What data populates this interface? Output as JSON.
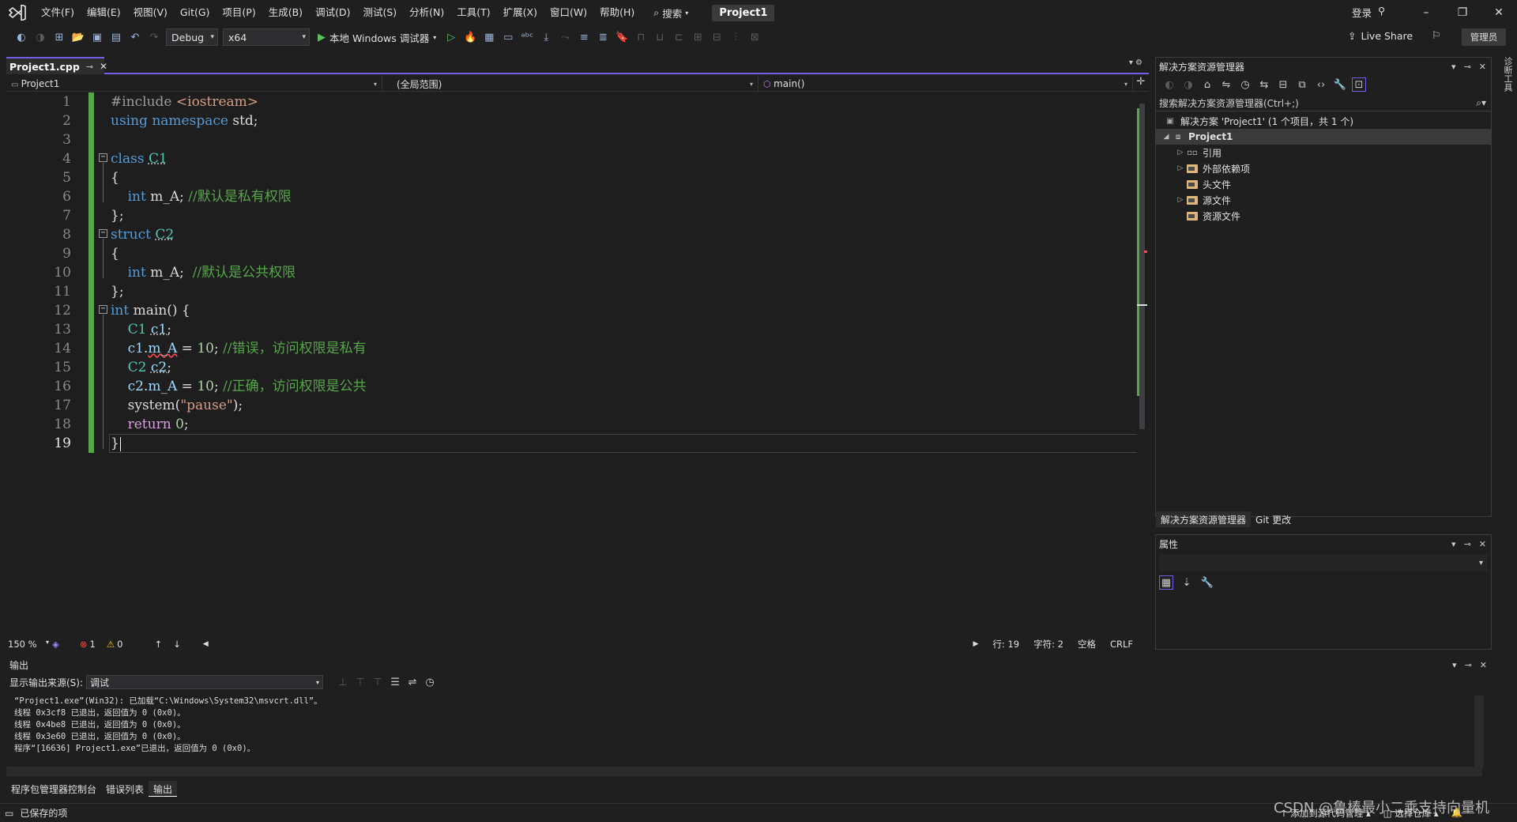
{
  "menubar": {
    "items": [
      "文件(F)",
      "编辑(E)",
      "视图(V)",
      "Git(G)",
      "项目(P)",
      "生成(B)",
      "调试(D)",
      "测试(S)",
      "分析(N)",
      "工具(T)",
      "扩展(X)",
      "窗口(W)",
      "帮助(H)"
    ],
    "search_label": "搜索",
    "project_title": "Project1",
    "login": "登录",
    "icons": {
      "logo": "visual-studio-logo",
      "search": "search-icon"
    }
  },
  "toolbar": {
    "config": "Debug",
    "platform": "x64",
    "run_label": "本地 Windows 调试器",
    "liveshare": "Live Share",
    "admin": "管理员"
  },
  "editor": {
    "tab_label": "Project1.cpp",
    "nav": {
      "project": "Project1",
      "scope": "(全局范围)",
      "member": "main()"
    },
    "line_numbers": [
      "1",
      "2",
      "3",
      "4",
      "5",
      "6",
      "7",
      "8",
      "9",
      "10",
      "11",
      "12",
      "13",
      "14",
      "15",
      "16",
      "17",
      "18",
      "19"
    ],
    "current_line": 19
  },
  "editor_status": {
    "zoom": "150 %",
    "errors": "1",
    "warnings": "0",
    "row": "行: 19",
    "col": "字符: 2",
    "whitespace": "空格",
    "eol": "CRLF"
  },
  "solution_explorer": {
    "title": "解决方案资源管理器",
    "search_placeholder": "搜索解决方案资源管理器(Ctrl+;)",
    "solution_line": "解决方案 'Project1' (1 个项目，共 1 个)",
    "project": "Project1",
    "nodes": [
      "引用",
      "外部依赖项",
      "头文件",
      "源文件",
      "资源文件"
    ],
    "tabs": [
      "解决方案资源管理器",
      "Git 更改"
    ]
  },
  "properties": {
    "title": "属性"
  },
  "output": {
    "title": "输出",
    "source_label": "显示输出来源(S):",
    "source_value": "调试",
    "lines": [
      "“Project1.exe”(Win32): 已加载“C:\\Windows\\System32\\msvcrt.dll”。",
      "线程 0x3cf8 已退出，返回值为 0 (0x0)。",
      "线程 0x4be8 已退出，返回值为 0 (0x0)。",
      "线程 0x3e60 已退出，返回值为 0 (0x0)。",
      "程序“[16636] Project1.exe”已退出，返回值为 0 (0x0)。"
    ]
  },
  "bottom_tabs": [
    "程序包管理器控制台",
    "错误列表",
    "输出"
  ],
  "statusbar": {
    "saved": "已保存的项",
    "add_source": "添加到源代码管理",
    "select_repo": "选择仓库"
  },
  "right_rail": "诊断工具",
  "watermark": "CSDN @鲁棒最小二乘支持向量机",
  "colors": {
    "accent": "#7160e8",
    "change_bar": "#57a64a",
    "keyword": "#569cd6",
    "type": "#4ec9b0",
    "comment": "#57a64a"
  }
}
